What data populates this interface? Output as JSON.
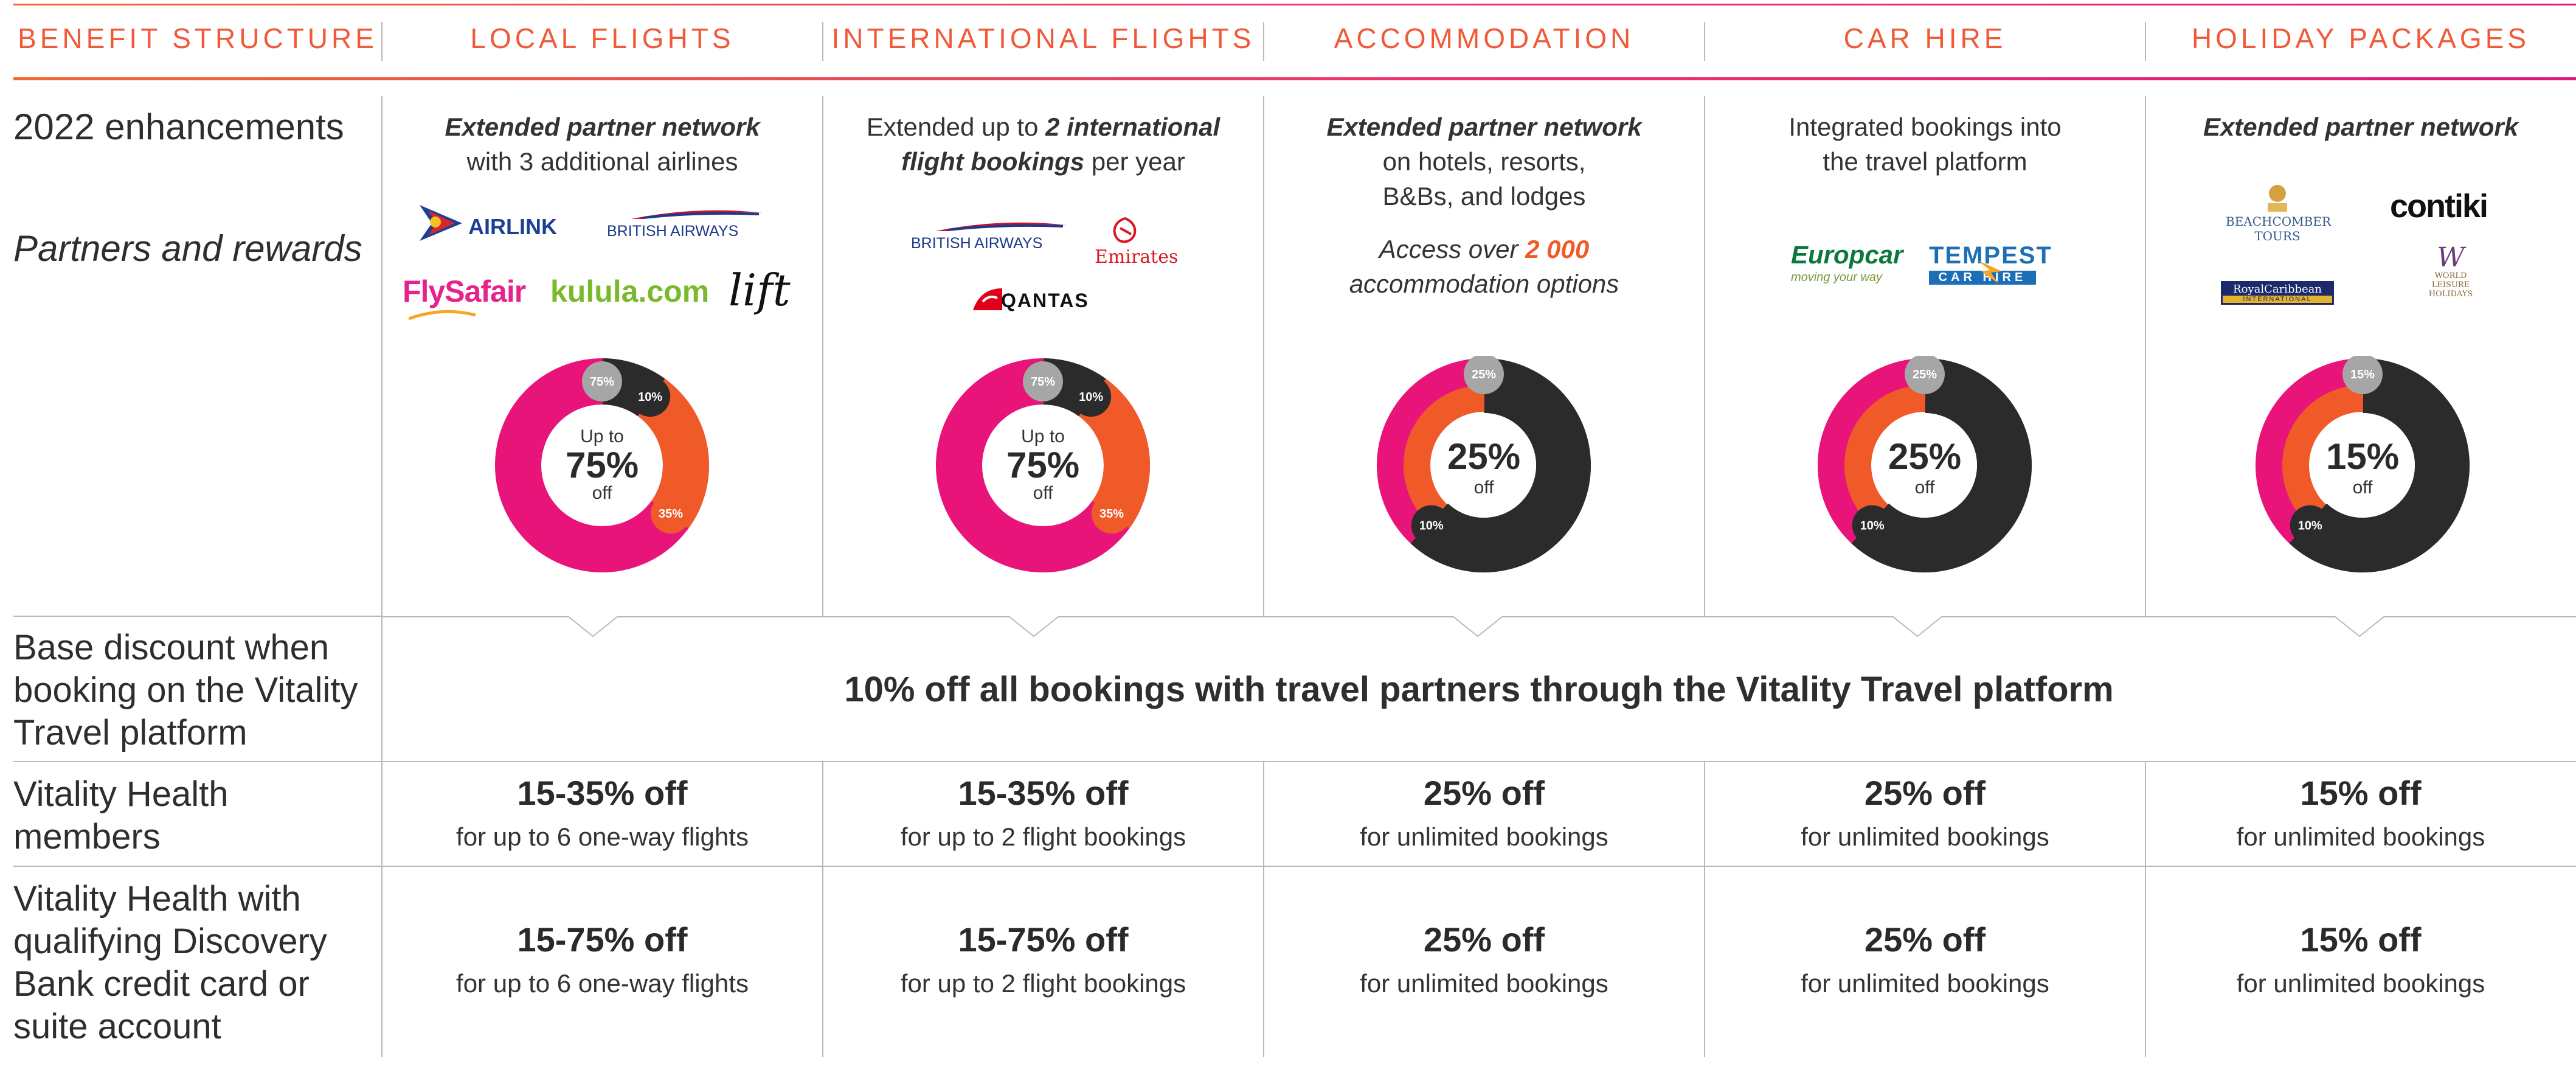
{
  "headers": [
    "BENEFIT STRUCTURE",
    "LOCAL FLIGHTS",
    "INTERNATIONAL FLIGHTS",
    "ACCOMMODATION",
    "CAR HIRE",
    "HOLIDAY PACKAGES"
  ],
  "row_labels": {
    "enhancements": "2022 enhancements",
    "partners": "Partners and rewards",
    "base": [
      "Base discount when",
      "booking on the Vitality",
      "Travel platform"
    ],
    "health": [
      "Vitality Health",
      "members"
    ],
    "bank": [
      "Vitality Health with",
      "qualifying Discovery",
      "Bank credit card or",
      "suite account"
    ]
  },
  "columns": [
    {
      "enh_bold": "Extended partner network",
      "enh_rest": "with 3 additional airlines",
      "logos": [
        "AIRLINK",
        "BRITISH AIRWAYS",
        "FlySafair",
        "kulula.com",
        "lift"
      ],
      "donut": {
        "center_top": "Up to",
        "center_value": "75%",
        "center_bottom": "off",
        "segments": [
          {
            "label": "75%",
            "value": 75
          },
          {
            "label": "10%",
            "value": 10
          },
          {
            "label": "35%",
            "value": 35
          }
        ]
      },
      "health_value": "15-35% off",
      "health_sub": "for up to 6 one-way flights",
      "bank_value": "15-75% off",
      "bank_sub": "for up to 6 one-way flights"
    },
    {
      "enh_pre": "Extended up to ",
      "enh_bold1": "2 international",
      "enh_bold2": "flight bookings",
      "enh_post": " per year",
      "logos": [
        "BRITISH AIRWAYS",
        "Emirates",
        "QANTAS"
      ],
      "donut": {
        "center_top": "Up to",
        "center_value": "75%",
        "center_bottom": "off",
        "segments": [
          {
            "label": "75%",
            "value": 75
          },
          {
            "label": "10%",
            "value": 10
          },
          {
            "label": "35%",
            "value": 35
          }
        ]
      },
      "health_value": "15-35% off",
      "health_sub": "for up to 2 flight bookings",
      "bank_value": "15-75% off",
      "bank_sub": "for up to 2 flight bookings"
    },
    {
      "enh_bold": "Extended partner network",
      "enh_rest1": "on hotels, resorts,",
      "enh_rest2": "B&Bs, and lodges",
      "access_pre": "Access over ",
      "access_num": "2 000",
      "access_post": "accommodation options",
      "donut": {
        "center_value": "25%",
        "center_bottom": "off",
        "segments": [
          {
            "label": "25%",
            "value": 25
          },
          {
            "label": "10%",
            "value": 10
          }
        ]
      },
      "health_value": "25% off",
      "health_sub": "for unlimited bookings",
      "bank_value": "25% off",
      "bank_sub": "for unlimited bookings"
    },
    {
      "enh_rest1": "Integrated bookings into",
      "enh_rest2": "the travel platform",
      "logos": [
        "Europcar",
        "moving your way",
        "TEMPEST",
        "CAR HIRE"
      ],
      "donut": {
        "center_value": "25%",
        "center_bottom": "off",
        "segments": [
          {
            "label": "25%",
            "value": 25
          },
          {
            "label": "10%",
            "value": 10
          }
        ]
      },
      "health_value": "25% off",
      "health_sub": "for unlimited bookings",
      "bank_value": "25% off",
      "bank_sub": "for unlimited bookings"
    },
    {
      "enh_bold": "Extended partner network",
      "logos": [
        "BEACHCOMBER",
        "TOURS",
        "contiki",
        "RoyalCaribbean",
        "INTERNATIONAL",
        "WORLD",
        "LEISURE",
        "HOLIDAYS"
      ],
      "donut": {
        "center_value": "15%",
        "center_bottom": "off",
        "segments": [
          {
            "label": "15%",
            "value": 15
          },
          {
            "label": "10%",
            "value": 10
          }
        ]
      },
      "health_value": "15% off",
      "health_sub": "for unlimited bookings",
      "bank_value": "15% off",
      "bank_sub": "for unlimited bookings"
    }
  ],
  "base_discount": "10% off all bookings with travel partners through the Vitality Travel platform",
  "colors": {
    "orange": "#f05a28",
    "pink": "#e8147a",
    "dark": "#2b2b2b",
    "grey": "#a6a6a6"
  }
}
